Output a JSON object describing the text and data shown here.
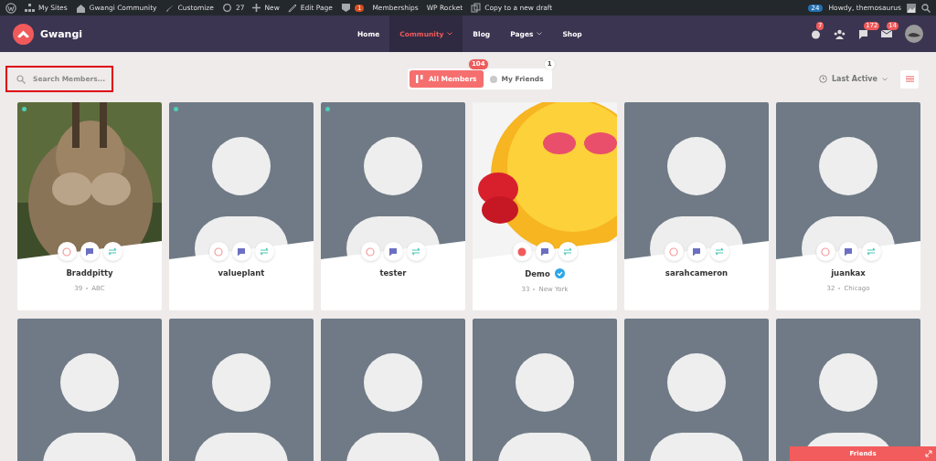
{
  "admin_bar": {
    "items": [
      {
        "kind": "wp"
      },
      {
        "kind": "sites",
        "label": "My Sites"
      },
      {
        "kind": "home",
        "label": "Gwangi Community"
      },
      {
        "kind": "brush",
        "label": "Customize"
      },
      {
        "kind": "sync",
        "label": "27"
      },
      {
        "kind": "plus",
        "label": "New"
      },
      {
        "kind": "pencil",
        "label": "Edit Page"
      },
      {
        "kind": "plugin",
        "badge": "1"
      },
      {
        "kind": "none",
        "label": "Memberships"
      },
      {
        "kind": "none",
        "label": "WP Rocket"
      },
      {
        "kind": "copy",
        "label": "Copy to a new draft"
      }
    ],
    "count_badge": "24",
    "greeting": "Howdy, themosaurus"
  },
  "header": {
    "logo": "Gwangi",
    "nav": [
      {
        "label": "Home",
        "selected": false,
        "dropdown": false
      },
      {
        "label": "Community",
        "selected": true,
        "dropdown": true
      },
      {
        "label": "Blog",
        "selected": false,
        "dropdown": false
      },
      {
        "label": "Pages",
        "selected": false,
        "dropdown": true
      },
      {
        "label": "Shop",
        "selected": false,
        "dropdown": false
      }
    ],
    "icons": [
      {
        "kind": "notifications",
        "badge": "7"
      },
      {
        "kind": "groups"
      },
      {
        "kind": "messages",
        "badge": "172"
      },
      {
        "kind": "inbox",
        "badge": "14"
      }
    ]
  },
  "toolbar": {
    "search": {
      "placeholder": "Search Members...",
      "highlighted": true
    },
    "tabs": [
      {
        "label": "All Members",
        "count": "104",
        "selected": true
      },
      {
        "label": "My Friends",
        "count": "1",
        "selected": false
      }
    ],
    "sort": "Last Active"
  },
  "members": [
    {
      "has_photo": true,
      "online": true,
      "name": "Braddpitty",
      "verified": false,
      "age": "39",
      "location": "ABC",
      "friend_requested": false
    },
    {
      "has_photo": false,
      "online": true,
      "name": "valueplant",
      "verified": false,
      "friend_requested": false
    },
    {
      "has_photo": false,
      "online": true,
      "name": "tester",
      "verified": false,
      "friend_requested": false
    },
    {
      "has_photo": true,
      "online": false,
      "name": "Demo",
      "verified": true,
      "age": "33",
      "location": "New York",
      "friend_requested": true
    },
    {
      "has_photo": false,
      "online": false,
      "name": "sarahcameron",
      "verified": false,
      "friend_requested": false
    },
    {
      "has_photo": false,
      "online": false,
      "name": "juankax",
      "verified": false,
      "age": "32",
      "location": "Chicago",
      "friend_requested": false
    },
    {
      "has_photo": false
    },
    {
      "has_photo": false
    },
    {
      "has_photo": false
    },
    {
      "has_photo": false
    },
    {
      "has_photo": false
    },
    {
      "has_photo": false
    }
  ],
  "friends_bar": {
    "label": "Friends"
  }
}
